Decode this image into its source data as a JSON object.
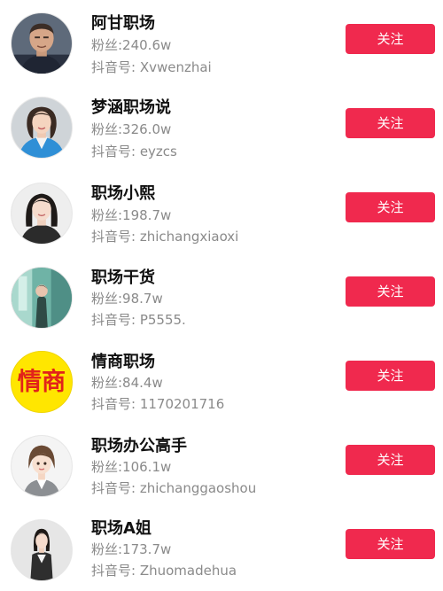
{
  "theme": {
    "follow_color": "#f0294e"
  },
  "accounts": [
    {
      "name": "阿甘职场",
      "fans": "粉丝:240.6w",
      "douyin_id": "抖音号: Xvwenzhai",
      "follow_label": "关注",
      "avatar_icon": "bald-man-portrait-icon"
    },
    {
      "name": "梦涵职场说",
      "fans": "粉丝:326.0w",
      "douyin_id": "抖音号: eyzcs",
      "follow_label": "关注",
      "avatar_icon": "woman-blue-blazer-portrait-icon"
    },
    {
      "name": "职场小熙",
      "fans": "粉丝:198.7w",
      "douyin_id": "抖音号: zhichangxiaoxi",
      "follow_label": "关注",
      "avatar_icon": "woman-portrait-icon"
    },
    {
      "name": "职场干货",
      "fans": "粉丝:98.7w",
      "douyin_id": "抖音号: P5555.",
      "follow_label": "关注",
      "avatar_icon": "teal-scene-portrait-icon"
    },
    {
      "name": "情商职场",
      "fans": "粉丝:84.4w",
      "douyin_id": "抖音号: 1170201716",
      "follow_label": "关注",
      "avatar_icon": "text-logo-icon",
      "avatar_text": "情商"
    },
    {
      "name": "职场办公高手",
      "fans": "粉丝:106.1w",
      "douyin_id": "抖音号: zhichanggaoshou",
      "follow_label": "关注",
      "avatar_icon": "cartoon-office-woman-icon"
    },
    {
      "name": "职场A姐",
      "fans": "粉丝:173.7w",
      "douyin_id": "抖音号: Zhuomadehua",
      "follow_label": "关注",
      "avatar_icon": "woman-full-body-portrait-icon"
    }
  ]
}
